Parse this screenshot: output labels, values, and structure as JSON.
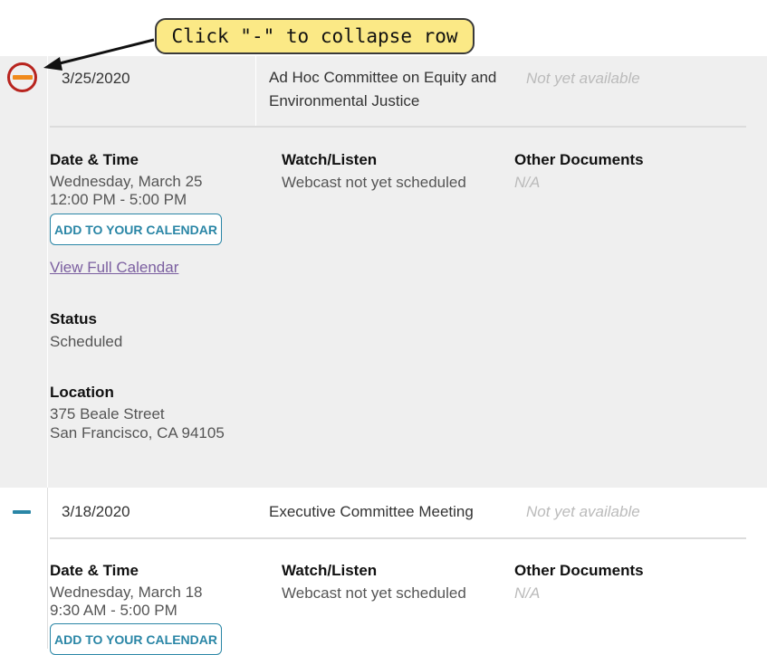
{
  "annotation": {
    "callout_text": "Click \"-\" to collapse row",
    "colors": {
      "callout_bg": "#fbe986",
      "ring": "#b8241e",
      "arrow": "#111111"
    }
  },
  "rows": [
    {
      "date": "3/25/2020",
      "title": "Ad Hoc Committee on Equity and Environmental Justice",
      "availability": "Not yet available",
      "collapse_icon": "minus-icon",
      "details": {
        "date_time_label": "Date & Time",
        "date_line": "Wednesday, March 25",
        "time_line": "12:00 PM - 5:00 PM",
        "calendar_button": "ADD TO YOUR CALENDAR",
        "full_calendar_link": "View Full Calendar",
        "watch_label": "Watch/Listen",
        "watch_value": "Webcast not yet scheduled",
        "docs_label": "Other Documents",
        "docs_value": "N/A",
        "status_label": "Status",
        "status_value": "Scheduled",
        "location_label": "Location",
        "location_line1": "375 Beale Street",
        "location_line2": "San Francisco, CA 94105"
      }
    },
    {
      "date": "3/18/2020",
      "title": "Executive Committee Meeting",
      "availability": "Not yet available",
      "collapse_icon": "minus-icon",
      "details": {
        "date_time_label": "Date & Time",
        "date_line": "Wednesday, March 18",
        "time_line": "9:30 AM - 5:00 PM",
        "calendar_button": "ADD TO YOUR CALENDAR",
        "watch_label": "Watch/Listen",
        "watch_value": "Webcast not yet scheduled",
        "docs_label": "Other Documents",
        "docs_value": "N/A"
      }
    }
  ],
  "colors": {
    "accent": "#2a86a6",
    "collapse_highlight": "#f08a1c",
    "row_highlight_bg": "#efefef",
    "link": "#7b5fa0"
  }
}
